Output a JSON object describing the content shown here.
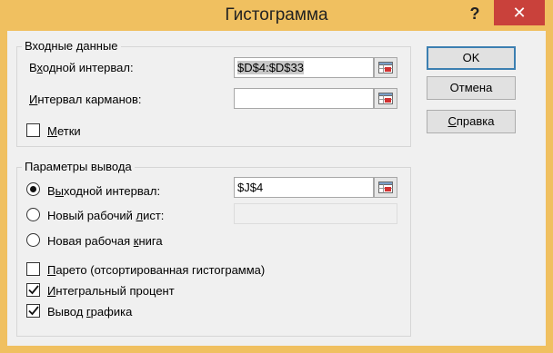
{
  "window": {
    "title": "Гистограмма",
    "help_label": "?",
    "close_label": "✕",
    "title_color": "#f0c060",
    "close_color": "#c9413b"
  },
  "input_group": {
    "legend": "Входные данные",
    "input_range": {
      "label_pre": "В",
      "label_ul": "х",
      "label_post": "одной интервал:",
      "value": "$D$4:$D$33"
    },
    "bin_range": {
      "label_ul": "И",
      "label_post": "нтервал карманов:",
      "value": ""
    },
    "labels_checkbox": {
      "label_ul": "М",
      "label_post": "етки",
      "checked": false
    }
  },
  "output_group": {
    "legend": "Параметры вывода",
    "output_range": {
      "label_pre": "В",
      "label_ul": "ы",
      "label_post": "ходной интервал:",
      "value": "$J$4",
      "selected": true
    },
    "new_sheet": {
      "label_pre": "Новый рабочий ",
      "label_ul": "л",
      "label_post": "ист:",
      "value": "",
      "selected": false
    },
    "new_workbook": {
      "label_pre": "Новая рабочая ",
      "label_ul": "к",
      "label_post": "нига",
      "selected": false
    },
    "pareto": {
      "label_ul": "П",
      "label_post": "арето (отсортированная гистограмма)",
      "checked": false
    },
    "cumulative": {
      "label_ul": "И",
      "label_post": "нтегральный процент",
      "checked": true
    },
    "chart_output": {
      "label_pre": "Вывод ",
      "label_ul": "г",
      "label_post": "рафика",
      "checked": true
    }
  },
  "buttons": {
    "ok": "OK",
    "cancel": "Отмена",
    "help_pre": "",
    "help_ul": "С",
    "help_post": "правка"
  },
  "icons": {
    "range_selector": "range-select-icon",
    "check": "checkmark-icon"
  }
}
